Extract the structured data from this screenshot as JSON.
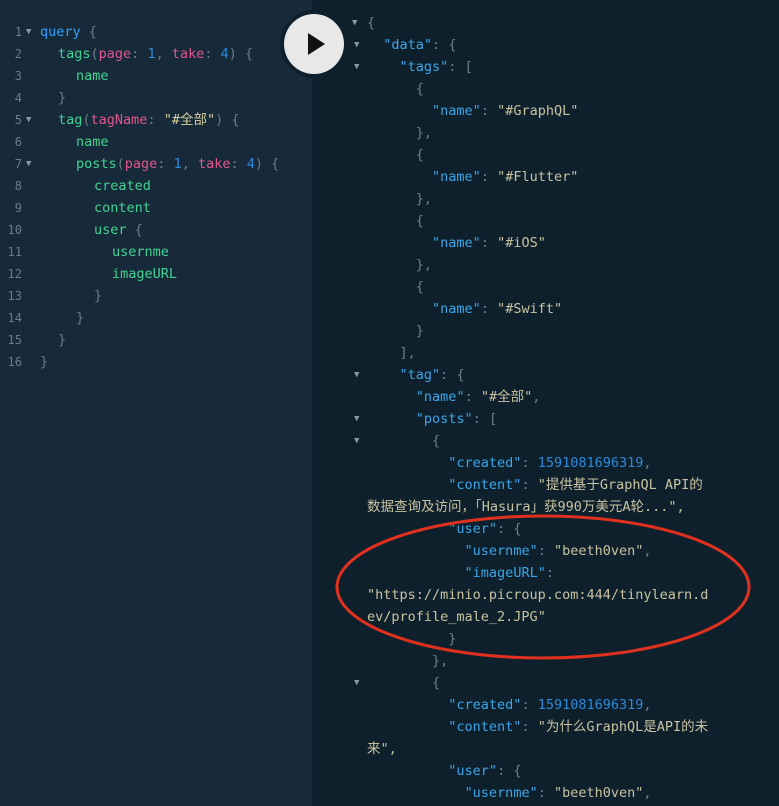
{
  "query_editor": {
    "line_numbers": [
      "1",
      "2",
      "3",
      "4",
      "5",
      "6",
      "7",
      "8",
      "9",
      "10",
      "11",
      "12",
      "13",
      "14",
      "15",
      "16"
    ],
    "lines": [
      {
        "i": 0,
        "t": "query",
        "b": " {"
      },
      {
        "i": 1,
        "t": "tags",
        "o": "(",
        "a1": "page",
        "c1": ": ",
        "n1": "1",
        "s": ", ",
        "a2": "take",
        "c2": ": ",
        "n2": "4",
        "cl": ") {"
      },
      {
        "i": 2,
        "t": "name"
      },
      {
        "i": 1,
        "t": "}"
      },
      {
        "i": 1,
        "t": "tag",
        "o": "(",
        "a1": "tagName",
        "c1": ": ",
        "sv": "\"#全部\"",
        "cl": ") {"
      },
      {
        "i": 2,
        "t": "name"
      },
      {
        "i": 2,
        "t": "posts",
        "o": "(",
        "a1": "page",
        "c1": ": ",
        "n1": "1",
        "s": ", ",
        "a2": "take",
        "c2": ": ",
        "n2": "4",
        "cl": ") {"
      },
      {
        "i": 3,
        "t": "created"
      },
      {
        "i": 3,
        "t": "content"
      },
      {
        "i": 3,
        "t": "user",
        "b": " {"
      },
      {
        "i": 4,
        "t": "usernme"
      },
      {
        "i": 4,
        "t": "imageURL"
      },
      {
        "i": 3,
        "t": "}"
      },
      {
        "i": 2,
        "t": "}"
      },
      {
        "i": 1,
        "t": "}"
      },
      {
        "i": 0,
        "t": "}"
      }
    ]
  },
  "result_viewer": {
    "lines": [
      "{",
      "  \"data\": {",
      "    \"tags\": [",
      "      {",
      "        \"name\": \"#GraphQL\"",
      "      },",
      "      {",
      "        \"name\": \"#Flutter\"",
      "      },",
      "      {",
      "        \"name\": \"#iOS\"",
      "      },",
      "      {",
      "        \"name\": \"#Swift\"",
      "      }",
      "    ],",
      "    \"tag\": {",
      "      \"name\": \"#全部\",",
      "      \"posts\": [",
      "        {",
      "          \"created\": 1591081696319,",
      "          \"content\": \"提供基于GraphQL API的",
      "数据查询及访问，「Hasura」获990万美元A轮...\",",
      "          \"user\": {",
      "            \"usernme\": \"beeth0ven\",",
      "            \"imageURL\":",
      "\"https://minio.picroup.com:444/tinylearn.d",
      "ev/profile_male_2.JPG\"",
      "          }",
      "        },",
      "        {",
      "          \"created\": 1591081696319,",
      "          \"content\": \"为什么GraphQL是API的未",
      "来\",",
      "          \"user\": {",
      "            \"usernme\": \"beeth0ven\","
    ]
  },
  "toolbar": {
    "run_icon": "play-icon"
  },
  "colors": {
    "editor_bg": "#172a3a",
    "result_bg": "#0f202d",
    "annotation": "#e0311f"
  }
}
